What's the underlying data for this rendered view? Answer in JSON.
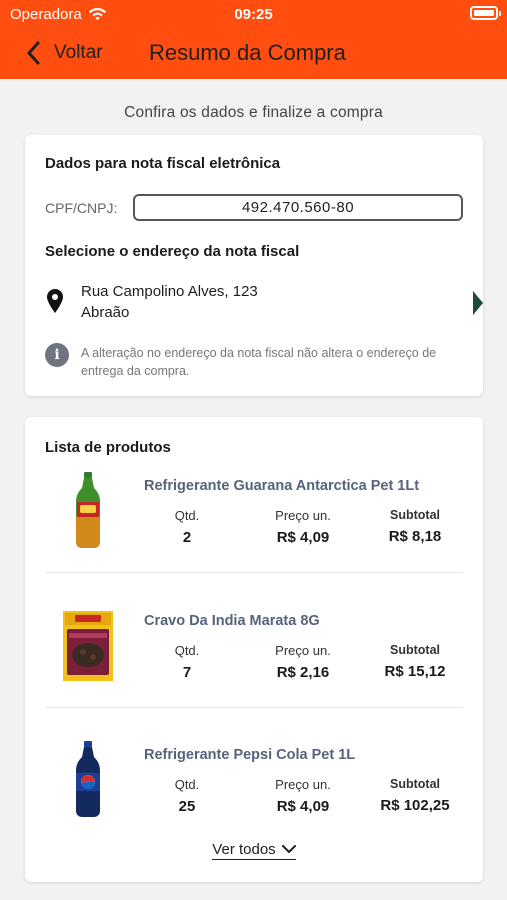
{
  "status_bar": {
    "carrier": "Operadora",
    "time": "09:25"
  },
  "header": {
    "back_label": "Voltar",
    "title": "Resumo da Compra",
    "bg_color": "#ff4e0f"
  },
  "subtitle": "Confira os dados e finalize a compra",
  "invoice": {
    "title": "Dados para nota fiscal eletrônica",
    "cpf_label": "CPF/CNPJ:",
    "cpf_value": "492.470.560-80",
    "address_title": "Selecione o endereço da nota fiscal",
    "address_line1": "Rua Campolino Alves, 123",
    "address_line2": "Abraão",
    "info_text": "A alteração no endereço da nota fiscal não altera o endereço de entrega da compra."
  },
  "products": {
    "title": "Lista de produtos",
    "qty_label": "Qtd.",
    "price_label": "Preço un.",
    "subtotal_label": "Subtotal",
    "items": [
      {
        "name": "Refrigerante Guarana Antarctica Pet 1Lt",
        "qty": "2",
        "price": "R$ 4,09",
        "subtotal": "R$ 8,18",
        "image": "guarana-bottle"
      },
      {
        "name": "Cravo Da India Marata 8G",
        "qty": "7",
        "price": "R$ 2,16",
        "subtotal": "R$ 15,12",
        "image": "cravo-package"
      },
      {
        "name": "Refrigerante Pepsi Cola Pet 1L",
        "qty": "25",
        "price": "R$ 4,09",
        "subtotal": "R$ 102,25",
        "image": "pepsi-bottle"
      }
    ],
    "see_all_label": "Ver todos"
  }
}
